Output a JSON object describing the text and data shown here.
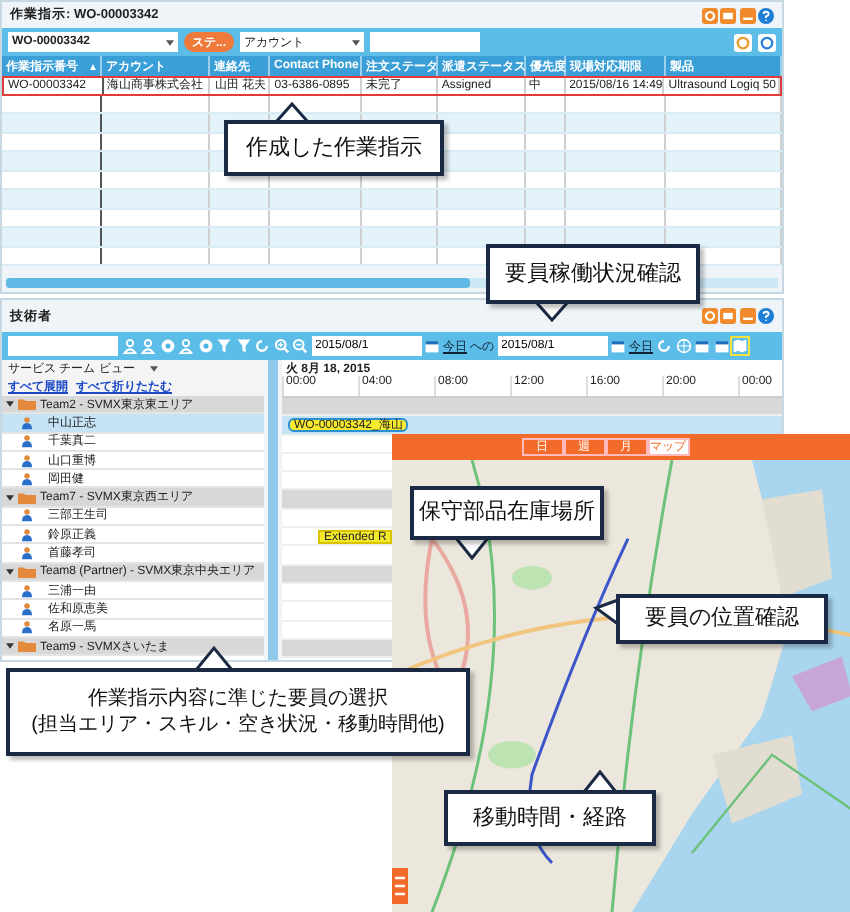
{
  "work_order": {
    "title": "作業指示: WO-00003342",
    "record_select": "WO-00003342",
    "status_button": "ステ...",
    "account_select": "アカウント",
    "columns": [
      {
        "label": "作業指示番号",
        "sorted": true
      },
      {
        "label": "アカウント"
      },
      {
        "label": "連絡先"
      },
      {
        "label": "Contact Phone"
      },
      {
        "label": "注文ステータ"
      },
      {
        "label": "派遣ステータス"
      },
      {
        "label": "優先度"
      },
      {
        "label": "現場対応期限"
      },
      {
        "label": "製品"
      }
    ],
    "rows": [
      {
        "selected": true,
        "cells": [
          "WO-00003342",
          "海山商事株式会社",
          "山田 花夫",
          "03-6386-0895",
          "未完了",
          "Assigned",
          "中",
          "2015/08/16 14:49",
          "Ultrasound Logiq 50"
        ]
      }
    ]
  },
  "technicians": {
    "title": "技術者",
    "date_from": "2015/08/1",
    "today_from": "今日",
    "to_label": "への",
    "date_to": "2015/08/1",
    "today_to": "今日",
    "view_select": "サービス チーム ビュー",
    "links": [
      "すべて展開",
      "すべて折りたたむ"
    ],
    "gantt_date": "火 8月 18, 2015",
    "hours": [
      "00:00",
      "04:00",
      "08:00",
      "12:00",
      "16:00",
      "20:00",
      "00:00"
    ],
    "teams": [
      {
        "label": "Team2 - SVMX東京東エリア",
        "expanded": true,
        "children": [
          {
            "label": "中山正志",
            "selected": true,
            "event": "WO-00003342_海山"
          },
          {
            "label": "千葉真二",
            "selected": false
          },
          {
            "label": "山口重博",
            "selected": false
          },
          {
            "label": "岡田健",
            "selected": false
          }
        ]
      },
      {
        "label": "Team7 - SVMX東京西エリア",
        "expanded": true,
        "children": [
          {
            "label": "三部王生司",
            "selected": false
          },
          {
            "label": "鈴原正義",
            "selected": false,
            "event": "Extended R"
          },
          {
            "label": "首藤孝司",
            "selected": false
          }
        ]
      },
      {
        "label": "Team8 (Partner) - SVMX東京中央エリア",
        "expanded": true,
        "children": [
          {
            "label": "三浦一由",
            "selected": false
          },
          {
            "label": "佐和原恵美",
            "selected": false
          },
          {
            "label": "名原一馬",
            "selected": false
          }
        ]
      },
      {
        "label": "Team9 - SVMXさいたま",
        "expanded": true
      }
    ]
  },
  "map_window": {
    "tabs": [
      {
        "label": "日",
        "selected": false
      },
      {
        "label": "週",
        "selected": false
      },
      {
        "label": "月",
        "selected": false
      },
      {
        "label": "マップ",
        "selected": true
      }
    ]
  },
  "callouts": [
    {
      "text": "作成した作業指示"
    },
    {
      "text": "要員稼働状況確認"
    },
    {
      "text": "保守部品在庫場所"
    },
    {
      "text": "要員の位置確認"
    },
    {
      "text": "移動時間・経路"
    },
    {
      "text": "作業指示内容に準じた要員の選択\n(担当エリア・スキル・空き状況・移動時間他)"
    }
  ]
}
